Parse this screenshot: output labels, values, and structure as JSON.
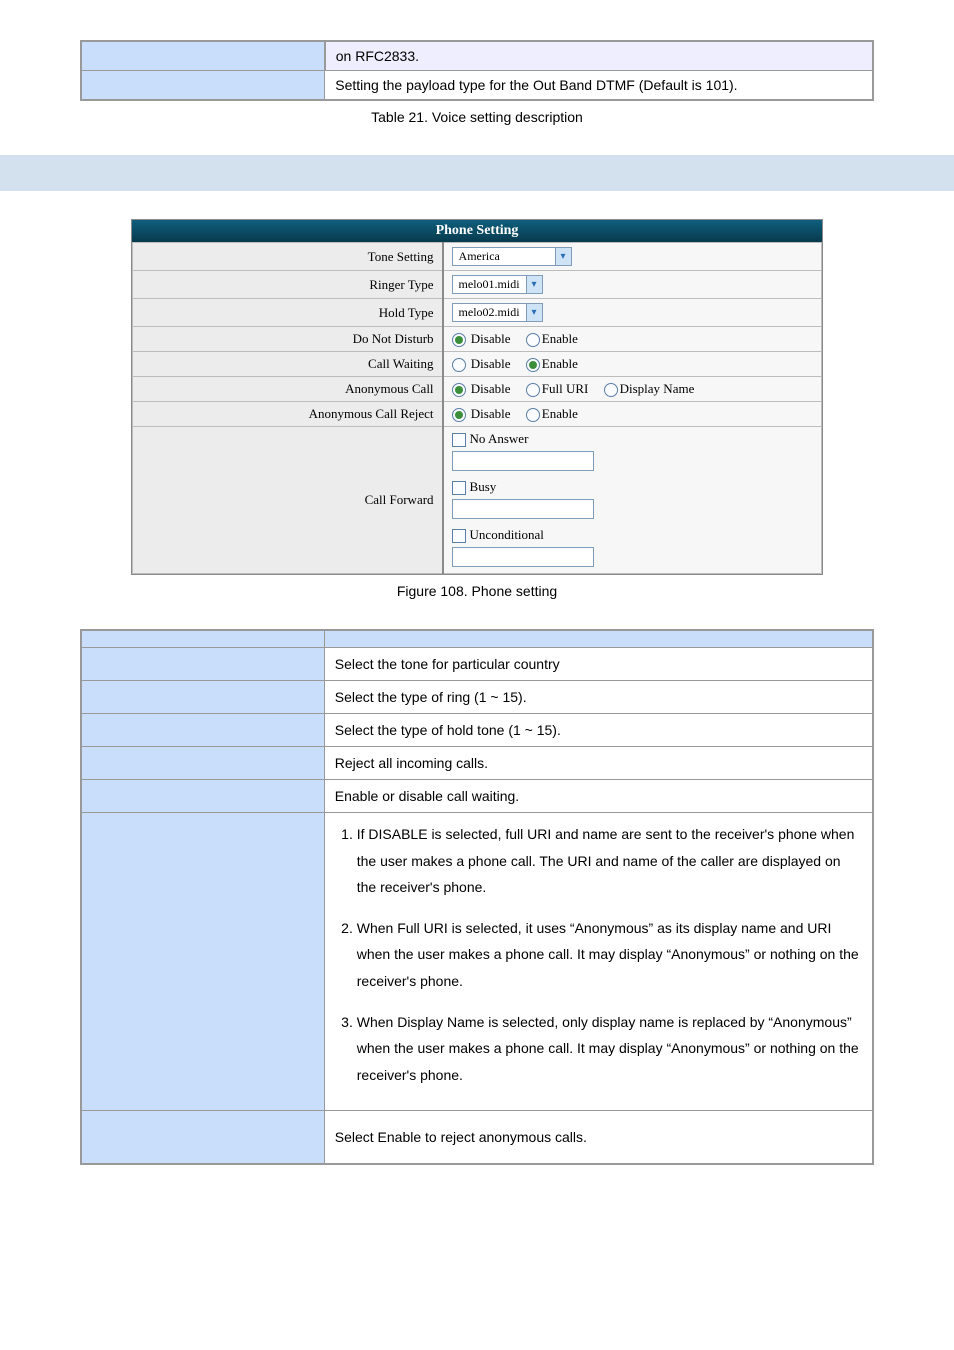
{
  "top_table": {
    "row1": {
      "lead": "",
      "text": "on RFC2833."
    },
    "row2": {
      "lead": "",
      "text": "Setting the payload type for the Out Band DTMF (Default is 101)."
    }
  },
  "top_caption": "Table 21. Voice setting description",
  "phone_setting": {
    "title": "Phone Setting",
    "rows": {
      "tone": {
        "label": "Tone Setting",
        "value": "America"
      },
      "ringer": {
        "label": "Ringer Type",
        "value": "melo01.midi"
      },
      "hold": {
        "label": "Hold Type",
        "value": "melo02.midi"
      },
      "dnd": {
        "label": "Do Not Disturb",
        "opt1": "Disable",
        "opt2": "Enable",
        "selected": "opt1"
      },
      "cw": {
        "label": "Call Waiting",
        "opt1": "Disable",
        "opt2": "Enable",
        "selected": "opt2"
      },
      "anon": {
        "label": "Anonymous Call",
        "opt1": "Disable",
        "opt2": "Full URI",
        "opt3": "Display Name",
        "selected": "opt1"
      },
      "anonrej": {
        "label": "Anonymous Call Reject",
        "opt1": "Disable",
        "opt2": "Enable",
        "selected": "opt1"
      },
      "cf": {
        "label": "Call Forward",
        "c1": "No Answer",
        "c2": "Busy",
        "c3": "Unconditional"
      }
    }
  },
  "figure_caption": "Figure 108. Phone setting",
  "desc": {
    "header": {
      "c1": "",
      "c2": ""
    },
    "rows": [
      {
        "label": "",
        "text": "Select the tone for particular country"
      },
      {
        "label": "",
        "text": "Select the type of ring (1 ~ 15)."
      },
      {
        "label": "",
        "text": "Select the type of hold tone (1 ~ 15)."
      },
      {
        "label": "",
        "text": "Reject all incoming calls."
      },
      {
        "label": "",
        "text": "Enable or disable call waiting."
      }
    ],
    "anon_label": "",
    "anon_items": [
      "If DISABLE is selected, full URI and name are sent to the receiver's phone when the user makes a phone call. The URI and name of the caller are displayed on the receiver's phone.",
      "When Full URI is selected, it uses “Anonymous” as its display name and URI when the user makes a phone call. It may display “Anonymous” or nothing on the receiver's phone.",
      "When Display Name is selected, only display name is replaced by “Anonymous” when the user makes a phone call. It may display “Anonymous” or nothing on the receiver's phone."
    ],
    "anonrej": {
      "label": "",
      "text": "Select Enable to reject anonymous calls."
    }
  }
}
